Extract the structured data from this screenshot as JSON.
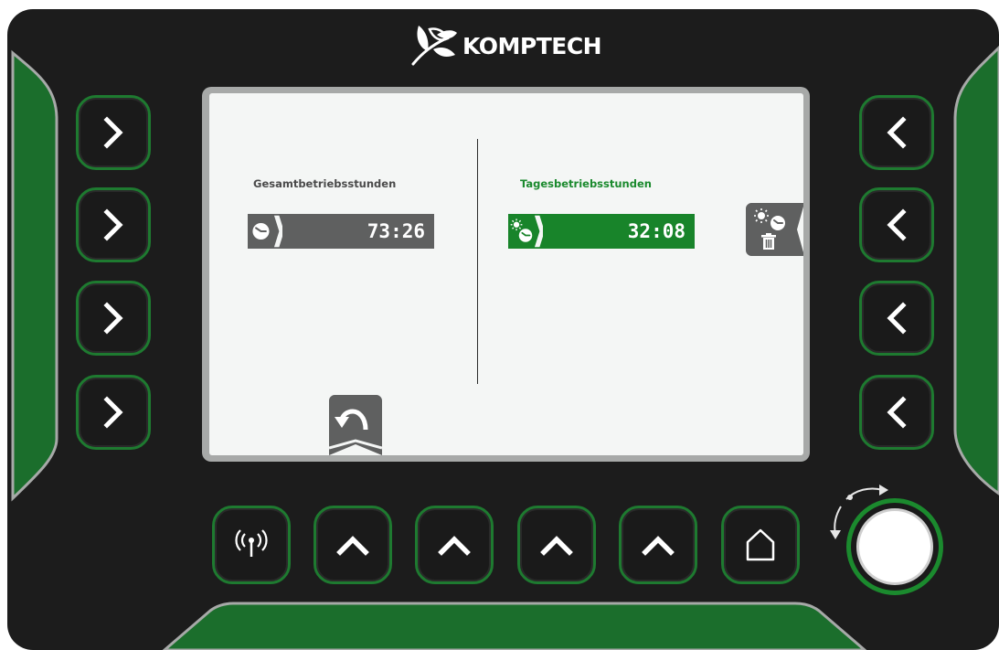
{
  "brand": {
    "name": "KOMPTECH",
    "logo_icon": "leaf-logo-icon"
  },
  "screen": {
    "left_panel": {
      "label": "Gesamtbetriebsstunden",
      "value": "73:26",
      "icon": "clock-icon"
    },
    "right_panel": {
      "label": "Tagesbetriebsstunden",
      "value": "32:08",
      "icon": "sun-clock-icon"
    },
    "reset_button": {
      "icon": "sun-clock-delete-icon"
    },
    "back_button": {
      "icon": "back-arrow-icon"
    }
  },
  "left_keys": [
    {
      "icon": "chevron-right-icon"
    },
    {
      "icon": "chevron-right-icon"
    },
    {
      "icon": "chevron-right-icon"
    },
    {
      "icon": "chevron-right-icon"
    }
  ],
  "right_keys": [
    {
      "icon": "chevron-left-icon"
    },
    {
      "icon": "chevron-left-icon"
    },
    {
      "icon": "chevron-left-icon"
    },
    {
      "icon": "chevron-left-icon"
    }
  ],
  "bottom_keys": [
    {
      "icon": "antenna-icon"
    },
    {
      "icon": "chevron-up-icon"
    },
    {
      "icon": "chevron-up-icon"
    },
    {
      "icon": "chevron-up-icon"
    },
    {
      "icon": "chevron-up-icon"
    },
    {
      "icon": "home-icon"
    }
  ],
  "colors": {
    "accent_green": "#1b8a2e",
    "bezel": "#1c1c1c",
    "screen_bg": "#f4f6f5",
    "readout_gray": "#5f6060"
  }
}
